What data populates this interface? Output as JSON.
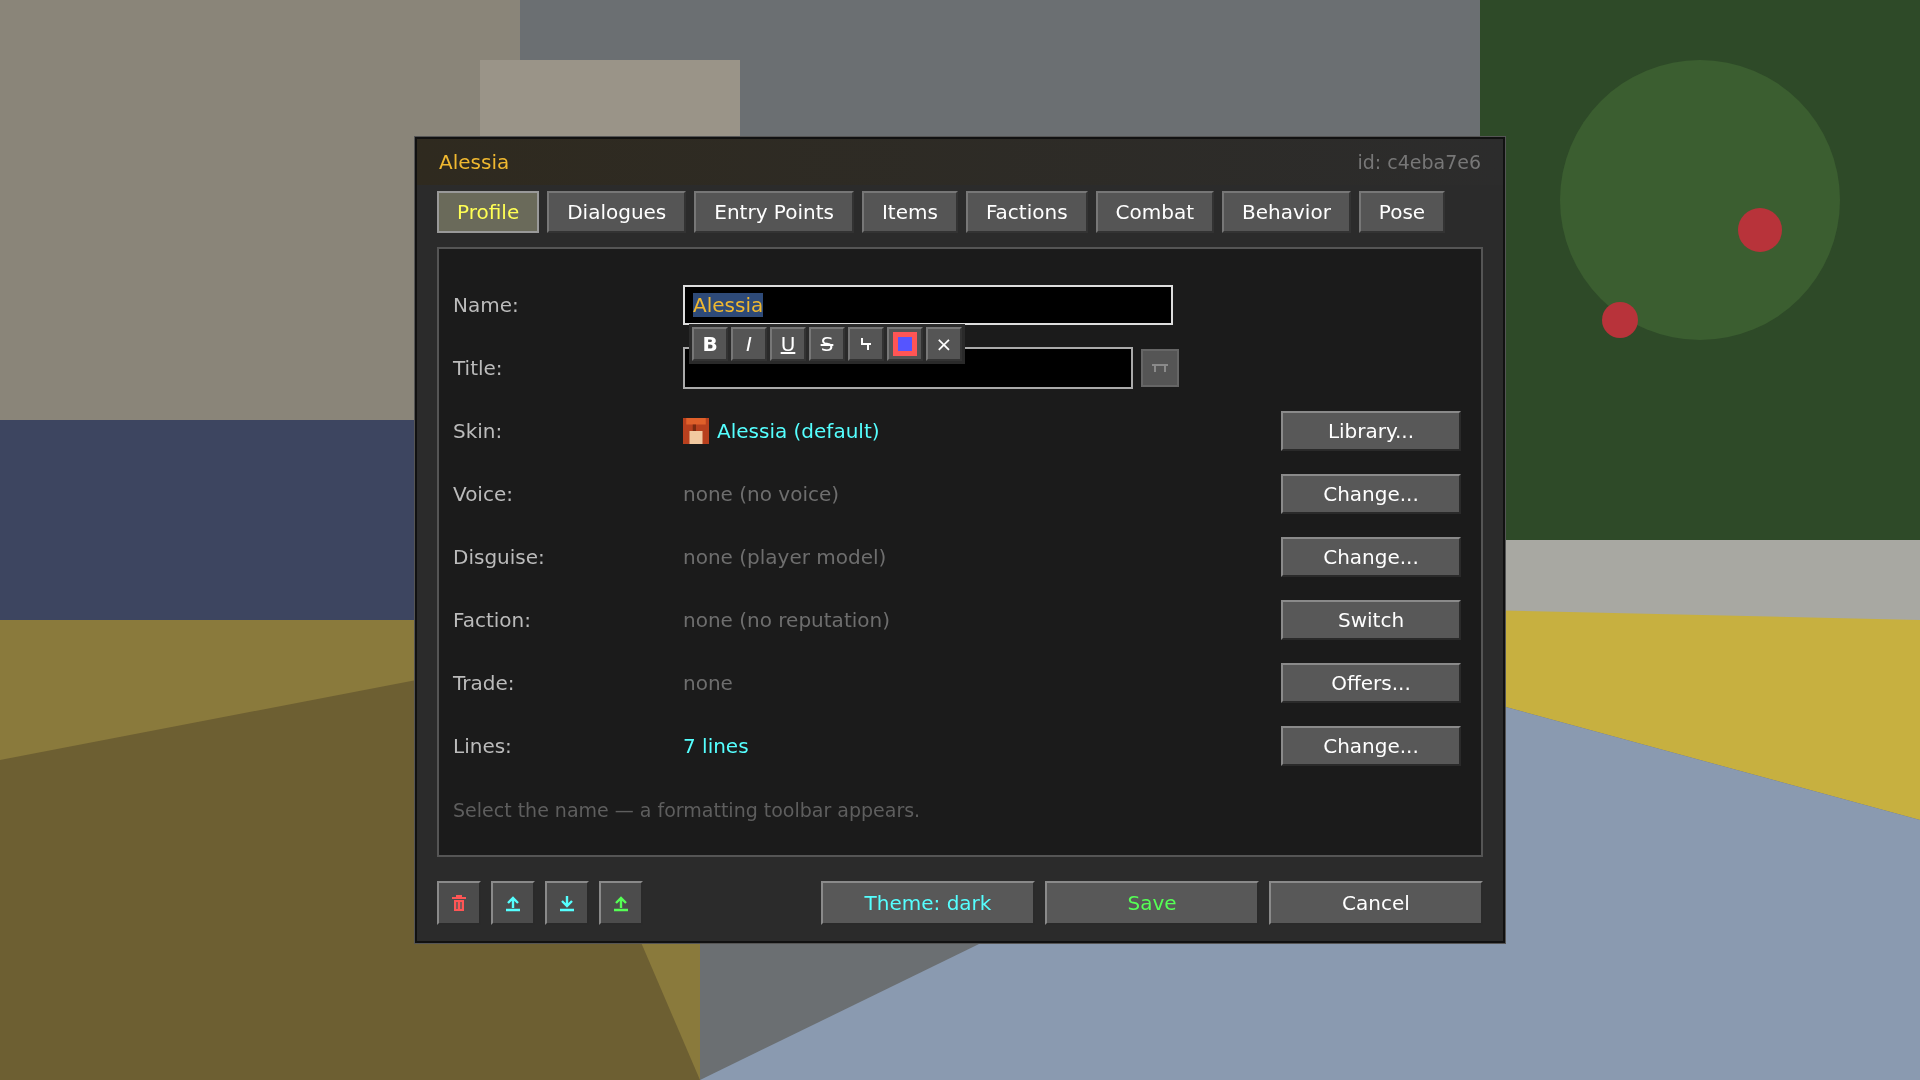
{
  "dialog": {
    "title": "Alessia",
    "id_label": "id: c4eba7e6"
  },
  "tabs": [
    {
      "label": "Profile",
      "selected": true
    },
    {
      "label": "Dialogues",
      "selected": false
    },
    {
      "label": "Entry Points",
      "selected": false
    },
    {
      "label": "Items",
      "selected": false
    },
    {
      "label": "Factions",
      "selected": false
    },
    {
      "label": "Combat",
      "selected": false
    },
    {
      "label": "Behavior",
      "selected": false
    },
    {
      "label": "Pose",
      "selected": false
    }
  ],
  "name_field": {
    "label": "Name:",
    "value": "Alessia",
    "text_selected": true
  },
  "format_toolbar": [
    {
      "kind": "bold",
      "glyph": "B"
    },
    {
      "kind": "italic",
      "glyph": "I"
    },
    {
      "kind": "underline",
      "glyph": "U"
    },
    {
      "kind": "strike",
      "glyph": "S"
    },
    {
      "kind": "magic"
    },
    {
      "kind": "color",
      "color": "#5555ff"
    },
    {
      "kind": "clear",
      "glyph": "×"
    }
  ],
  "title_field": {
    "label": "Title:"
  },
  "rows": [
    {
      "label": "Skin:",
      "value": "Alessia (default)",
      "color": "#55ffff",
      "kind": "skin",
      "button": "Library..."
    },
    {
      "label": "Voice:",
      "value": "none (no voice)",
      "color": "#6e6e6e",
      "kind": "plain",
      "button": "Change..."
    },
    {
      "label": "Disguise:",
      "value": "none (player model)",
      "color": "#6e6e6e",
      "kind": "plain",
      "button": "Change..."
    },
    {
      "label": "Faction:",
      "value": "none (no reputation)",
      "color": "#6e6e6e",
      "kind": "plain",
      "button": "Switch"
    },
    {
      "label": "Trade:",
      "value": "none",
      "color": "#6e6e6e",
      "kind": "plain",
      "button": "Offers..."
    },
    {
      "label": "Lines:",
      "value": "7 lines",
      "color": "#55ffff",
      "kind": "plain",
      "button": "Change..."
    }
  ],
  "hint": "Select the name — a formatting toolbar appears.",
  "icon_buttons": [
    {
      "kind": "delete"
    },
    {
      "kind": "export"
    },
    {
      "kind": "import"
    },
    {
      "kind": "upload"
    }
  ],
  "actions": [
    {
      "label": "Theme: dark",
      "kind": "theme"
    },
    {
      "label": "Save",
      "kind": "save"
    },
    {
      "label": "Cancel",
      "kind": "cancel"
    }
  ]
}
